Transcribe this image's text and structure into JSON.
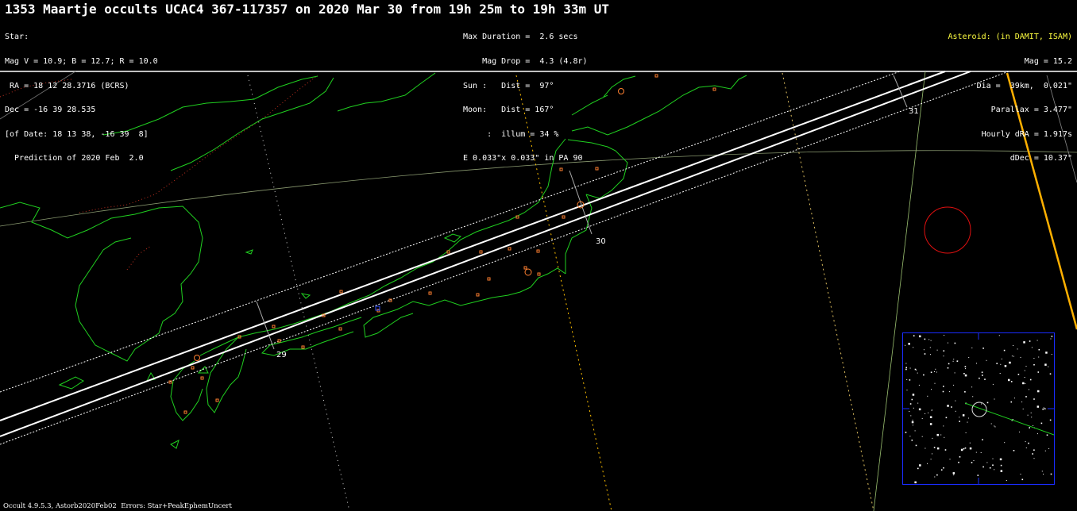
{
  "title": "1353 Maartje occults UCAC4 367-117357 on 2020 Mar 30 from 19h 25m to 19h 33m UT",
  "star": {
    "header": "Star:",
    "mag": "Mag V = 10.9; B = 12.7; R = 10.0",
    "ra": " RA = 18 12 28.3716 (BCRS)",
    "dec": "Dec = -16 39 28.535",
    "of_date": "[of Date: 18 13 38, -16 39  8]",
    "prediction": "  Prediction of 2020 Feb  2.0"
  },
  "event": {
    "max_duration": "Max Duration =  2.6 secs",
    "mag_drop": "    Mag Drop =  4.3 (4.8r)",
    "sun": "Sun :   Dist =  97°",
    "moon": "Moon:   Dist = 167°",
    "illum": "     :  illum = 34 %",
    "ellipse": "E 0.033\"x 0.033\" in PA 90"
  },
  "asteroid": {
    "header": "Asteroid: (in DAMIT, ISAM)",
    "mag": "Mag = 15.2",
    "dia": "Dia =  39km,  0.021\"",
    "parallax": "Parallax = 3.477\"",
    "hourly_dra": "Hourly dRA = 1.917s",
    "ddec": "dDec = 10.37\""
  },
  "time_ticks": [
    "29",
    "30",
    "31"
  ],
  "footer": "Occult 4.9.5.3, Astorb2020Feb02  Errors: Star+PeakEphemUncert",
  "colors": {
    "coast": "#20d020",
    "path_line": "#ffffff",
    "uncertainty_line": "#ffffff",
    "sun_terminator": "#ffc000",
    "border": "#c03020",
    "cities": "#ff8030",
    "finder_frame": "#1a2cff",
    "ring": "#e01010",
    "title_asteroid": "#ffff40"
  }
}
